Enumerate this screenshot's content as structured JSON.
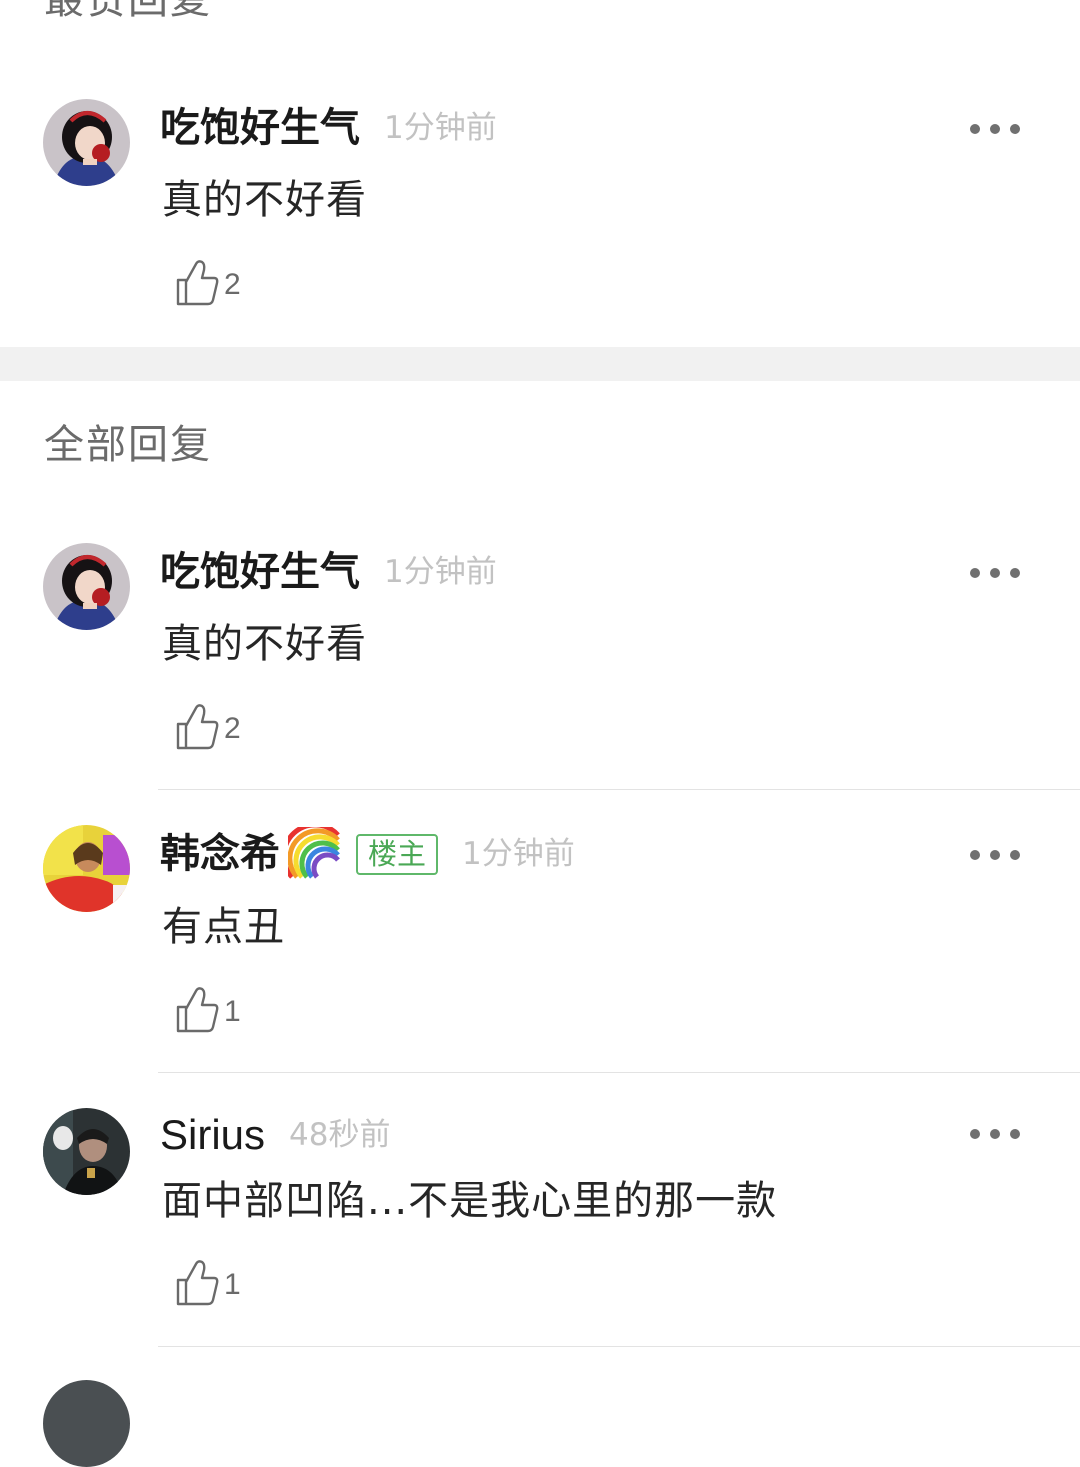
{
  "sections": {
    "top": "最赞回复",
    "all": "全部回复"
  },
  "hot_comments": [
    {
      "username": "吃饱好生气",
      "time": "1分钟前",
      "content": "真的不好看",
      "likes": "2",
      "avatar": "snow-white-avatar"
    }
  ],
  "comments": [
    {
      "username": "吃饱好生气",
      "time": "1分钟前",
      "content": "真的不好看",
      "likes": "2",
      "avatar": "snow-white-avatar"
    },
    {
      "username": "韩念希",
      "emoji": "rainbow-emoji",
      "badge": "楼主",
      "time": "1分钟前",
      "content": "有点丑",
      "likes": "1",
      "avatar": "colorful-portrait-avatar"
    },
    {
      "username": "Sirius",
      "time": "48秒前",
      "content": "面中部凹陷...不是我心里的那一款",
      "likes": "1",
      "avatar": "dark-portrait-avatar"
    }
  ],
  "colors": {
    "badge_green": "#4aa855",
    "time_gray": "#c2c2c2",
    "section_gray": "#6b6b6b",
    "band_gray": "#f1f1f1"
  }
}
